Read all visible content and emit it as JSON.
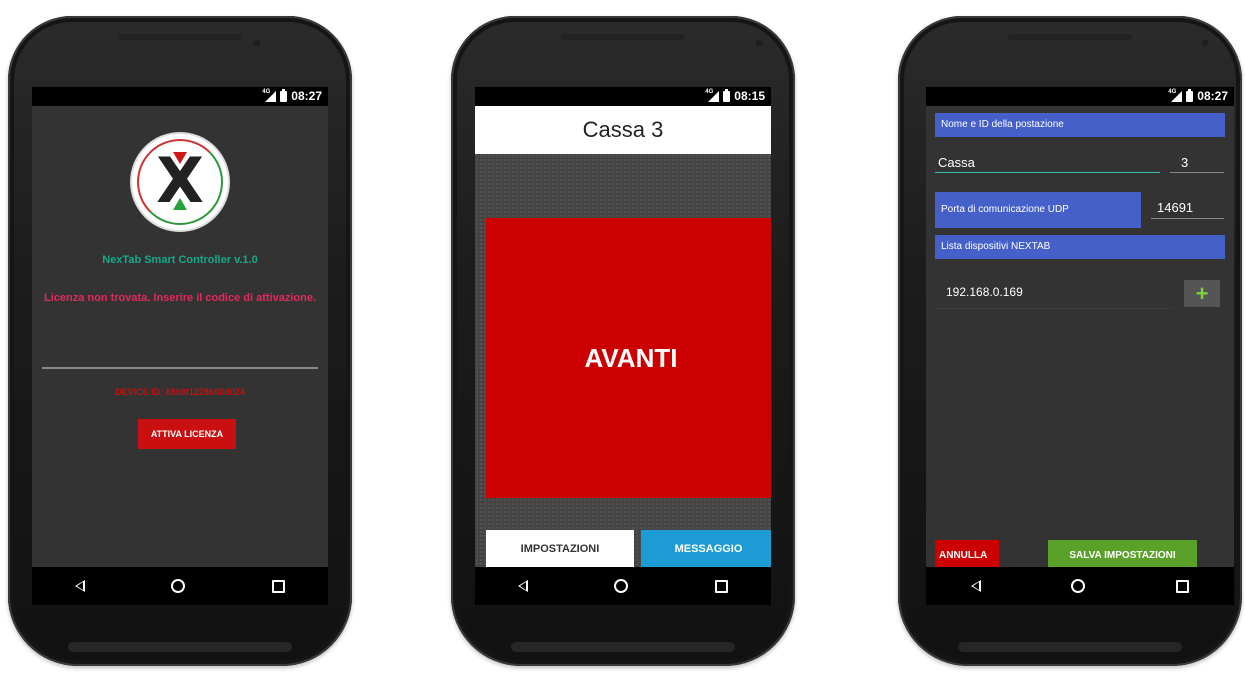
{
  "phones": [
    {
      "status": {
        "time": "08:27",
        "net": "4G"
      },
      "title": "NexTab Smart Controller v.1.0",
      "message": "Licenza non trovata. Inserire il codice di attivazione.",
      "device_id": "DEVICE ID: 8569f1228b60d024",
      "activate_label": "ATTIVA LICENZA"
    },
    {
      "status": {
        "time": "08:15",
        "net": "4G"
      },
      "header_title": "Cassa 3",
      "main_button_label": "AVANTI",
      "settings_label": "IMPOSTAZIONI",
      "message_label": "MESSAGGIO"
    },
    {
      "status": {
        "time": "08:27",
        "net": "4G"
      },
      "section_name_id": "Nome e ID della postazione",
      "name_value": "Cassa",
      "id_value": "3",
      "udp_label": "Porta di comunicazione UDP",
      "udp_value": "14691",
      "devices_section": "Lista dispositivi NEXTAB",
      "devices": [
        "192.168.0.169"
      ],
      "add_label": "+",
      "cancel_label": "ANNULLA",
      "save_label": "SALVA IMPOSTAZIONI"
    }
  ],
  "colors": {
    "accent_red": "#cc0000",
    "accent_blue": "#1c9bd4",
    "accent_green": "#5aa12a",
    "section_blue": "#4560c9",
    "teal_title": "#17a98a",
    "pink_message": "#e3285d"
  }
}
